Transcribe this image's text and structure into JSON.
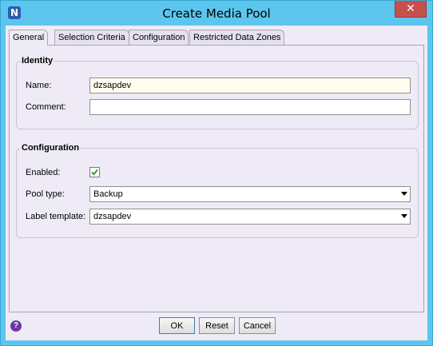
{
  "window": {
    "title": "Create Media Pool",
    "app_icon": "N",
    "close_label": "✕"
  },
  "tabs": [
    {
      "label": "General",
      "active": true
    },
    {
      "label": "Selection Criteria",
      "active": false
    },
    {
      "label": "Configuration",
      "active": false
    },
    {
      "label": "Restricted Data Zones",
      "active": false
    }
  ],
  "identity": {
    "legend": "Identity",
    "name_label": "Name:",
    "name_value": "dzsapdev",
    "comment_label": "Comment:",
    "comment_value": ""
  },
  "configuration": {
    "legend": "Configuration",
    "enabled_label": "Enabled:",
    "enabled": true,
    "pool_type_label": "Pool type:",
    "pool_type_value": "Backup",
    "label_template_label": "Label template:",
    "label_template_value": "dzsapdev"
  },
  "buttons": {
    "ok": "OK",
    "reset": "Reset",
    "cancel": "Cancel",
    "help": "?"
  }
}
